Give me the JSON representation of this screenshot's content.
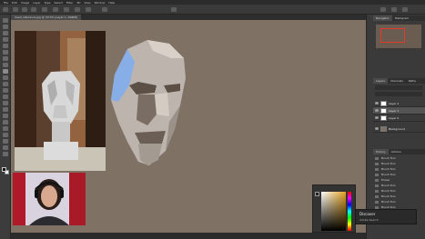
{
  "app": {
    "menu": [
      "File",
      "Edit",
      "Image",
      "Layer",
      "Type",
      "Select",
      "Filter",
      "3D",
      "View",
      "Window",
      "Help"
    ],
    "document_tab": "head_reference.jpg @ 33.3% (Layer 1, RGB/8)"
  },
  "layers_panel": {
    "tabs": [
      "Layers",
      "Channels",
      "Paths"
    ],
    "layers": [
      {
        "name": "Layer 2",
        "selected": false
      },
      {
        "name": "Layer 1",
        "selected": true
      },
      {
        "name": "Layer 0",
        "selected": false
      },
      {
        "name": "Background",
        "selected": false
      }
    ]
  },
  "navigator_panel": {
    "tabs": [
      "Navigator",
      "Histogram"
    ]
  },
  "history_panel": {
    "tabs": [
      "History",
      "Actions"
    ],
    "items": [
      "Brush Tool",
      "Brush Tool",
      "Brush Tool",
      "Brush Tool",
      "Eraser",
      "Brush Tool",
      "Brush Tool",
      "Brush Tool",
      "Brush Tool",
      "Brush Tool"
    ]
  },
  "tooltip": {
    "title": "Discover",
    "subtitle": "Adobe Search"
  },
  "colors": {
    "canvas": "#7f7265",
    "accent_red": "#e23a2a",
    "picker_field": "#d9b24a"
  }
}
